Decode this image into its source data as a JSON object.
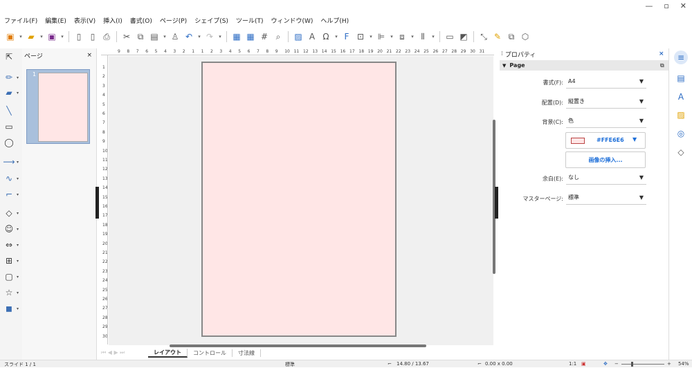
{
  "menubar": [
    "ファイル(F)",
    "編集(E)",
    "表示(V)",
    "挿入(I)",
    "書式(O)",
    "ページ(P)",
    "シェイプ(S)",
    "ツール(T)",
    "ウィンドウ(W)",
    "ヘルプ(H)"
  ],
  "pages_panel": {
    "title": "ページ",
    "close": "×",
    "thumb_number": "1"
  },
  "ruler": {
    "h": [
      "9",
      "8",
      "7",
      "6",
      "5",
      "4",
      "3",
      "2",
      "1",
      "1",
      "2",
      "3",
      "4",
      "5",
      "6",
      "7",
      "8",
      "9",
      "10",
      "11",
      "12",
      "13",
      "14",
      "15",
      "16",
      "17",
      "18",
      "19",
      "20",
      "21",
      "22",
      "23",
      "24",
      "25",
      "26",
      "27",
      "28",
      "29",
      "30",
      "31"
    ],
    "v": [
      "1",
      "2",
      "3",
      "4",
      "5",
      "6",
      "7",
      "8",
      "9",
      "10",
      "11",
      "12",
      "13",
      "14",
      "15",
      "16",
      "17",
      "18",
      "19",
      "20",
      "21",
      "22",
      "23",
      "24",
      "25",
      "26",
      "27",
      "28",
      "29",
      "30"
    ]
  },
  "tabs": [
    "レイアウト",
    "コントロール",
    "寸法線"
  ],
  "properties": {
    "title": "プロパティ",
    "close": "×",
    "section": "Page",
    "format_label": "書式(F):",
    "format_value": "A4",
    "orientation_label": "配置(D):",
    "orientation_value": "縦置き",
    "background_label": "背景(C):",
    "background_value": "色",
    "color_hex": "#FFE6E6",
    "insert_image": "画像の挿入...",
    "margin_label": "余白(E):",
    "margin_value": "なし",
    "master_label": "マスターページ:",
    "master_value": "標準"
  },
  "status": {
    "slide": "スライド 1 / 1",
    "master": "標準",
    "position": "14.80 / 13.67",
    "size": "0.00 x 0.00",
    "ratio": "1:1",
    "zoom": "54%"
  },
  "colors": {
    "page": "#ffe6e6",
    "accent": "#2c6cc4"
  }
}
